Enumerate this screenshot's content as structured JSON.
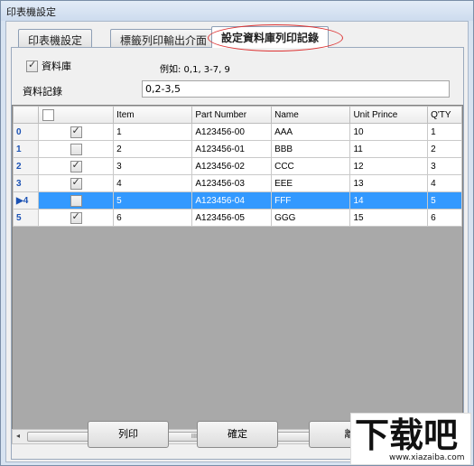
{
  "window": {
    "title": "印表機設定"
  },
  "tabs": [
    {
      "label": "印表機設定"
    },
    {
      "label": "標籤列印輸出介面"
    },
    {
      "label": "設定資料庫列印記錄"
    }
  ],
  "form": {
    "database_checkbox_label": "資料庫",
    "database_checked": true,
    "example_text": "例如: 0,1, 3-7, 9",
    "record_label": "資料記錄",
    "record_value": "0,2-3,5"
  },
  "grid": {
    "headers": [
      "",
      "",
      "Item",
      "Part Number",
      "Name",
      "Unit Prince",
      "Q'TY"
    ],
    "rows": [
      {
        "index": "0",
        "checked": true,
        "item": "1",
        "part": "A123456-00",
        "name": "AAA",
        "price": "10",
        "qty": "1",
        "selected": false
      },
      {
        "index": "1",
        "checked": false,
        "item": "2",
        "part": "A123456-01",
        "name": "BBB",
        "price": "11",
        "qty": "2",
        "selected": false
      },
      {
        "index": "2",
        "checked": true,
        "item": "3",
        "part": "A123456-02",
        "name": "CCC",
        "price": "12",
        "qty": "3",
        "selected": false
      },
      {
        "index": "3",
        "checked": true,
        "item": "4",
        "part": "A123456-03",
        "name": "EEE",
        "price": "13",
        "qty": "4",
        "selected": false
      },
      {
        "index": "▶4",
        "checked": false,
        "item": "5",
        "part": "A123456-04",
        "name": "FFF",
        "price": "14",
        "qty": "5",
        "selected": true
      },
      {
        "index": "5",
        "checked": true,
        "item": "6",
        "part": "A123456-05",
        "name": "GGG",
        "price": "15",
        "qty": "6",
        "selected": false
      }
    ]
  },
  "scrollbar": {
    "left": "◂",
    "right": "▸",
    "thumb": "III"
  },
  "buttons": {
    "print": "列印",
    "ok": "確定",
    "exit": "離"
  },
  "watermark": {
    "logo": "下载吧",
    "url": "www.xiazaiba.com"
  },
  "colors": {
    "selection": "#3399ff",
    "highlight_ring": "#d33333"
  }
}
